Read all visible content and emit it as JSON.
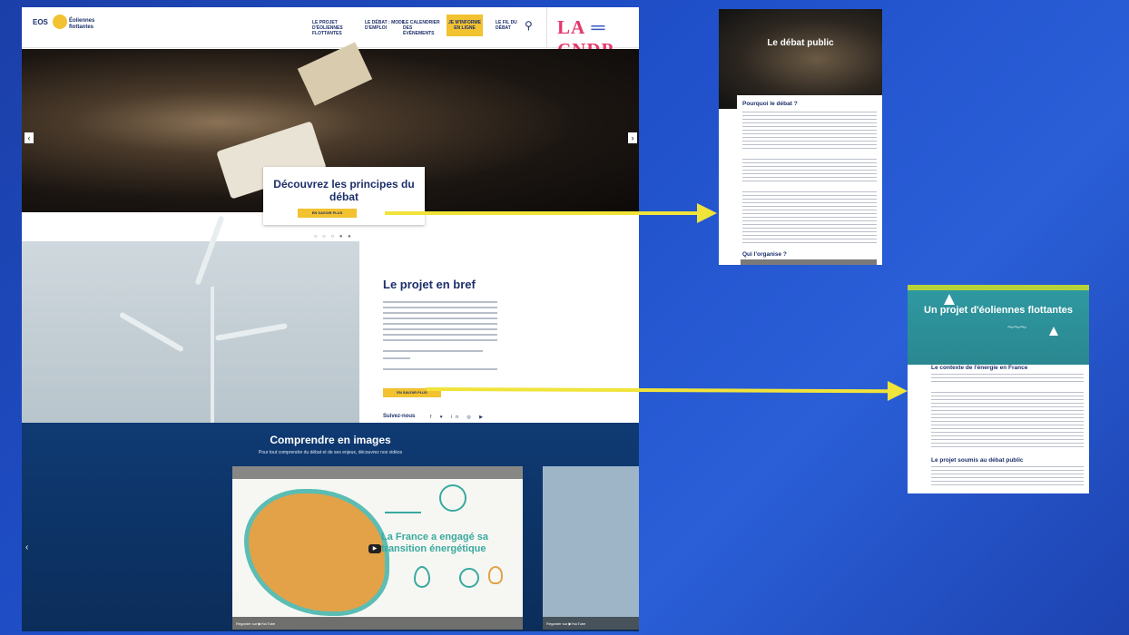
{
  "site": {
    "logo": {
      "brand": "EOS",
      "name": "Éoliennes flottantes"
    },
    "nav": [
      {
        "label": "LE PROJET D'ÉOLIENNES FLOTTANTES"
      },
      {
        "label": "LE DÉBAT : MODE D'EMPLOI"
      },
      {
        "label": "LE CALENDRIER DES ÉVÉNEMENTS"
      },
      {
        "label": "JE M'INFORME EN LIGNE"
      },
      {
        "label": "LE FIL DU DÉBAT"
      }
    ],
    "cndp_logo": {
      "left": "LA",
      "right": "CNDP"
    },
    "hero": {
      "title": "Découvrez les principes du débat",
      "button": "EN SAVOIR PLUS"
    },
    "carousel": {
      "dots": "○ ○ ○ ● ●"
    },
    "project": {
      "title": "Le projet en bref",
      "button": "EN SAVOIR PLUS",
      "follow": "Suivez-nous",
      "social": "f ♥ in ◎ ▶"
    },
    "images": {
      "title": "Comprendre en images",
      "subtitle": "Pour tout comprendre du débat et de ses enjeux, découvrez nos vidéos",
      "video": {
        "caption": "La France a engagé sa transition énergétique",
        "watch": "Regarder sur ▶YouTube"
      },
      "video2": {
        "watch": "Regarder sur ▶YouTube"
      }
    }
  },
  "panel_debat": {
    "title": "Le débat public",
    "h1": "Pourquoi le débat ?",
    "h2": "Qui l'organise ?"
  },
  "panel_projet": {
    "title": "Un projet d'éoliennes flottantes",
    "h1": "Le contexte de l'énergie en France",
    "h2": "Le projet soumis au débat public"
  },
  "colors": {
    "accent": "#f2c230",
    "navy": "#1d2f6b",
    "arrow": "#f0e33a",
    "background": "#1f4fc9"
  }
}
